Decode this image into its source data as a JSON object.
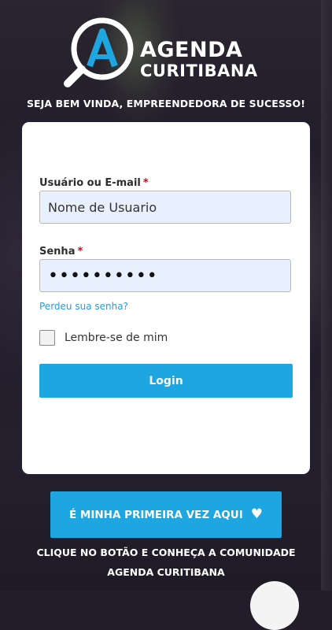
{
  "brand": {
    "line1": "AGENDA",
    "line2": "CURITIBANA",
    "accent_color": "#1ea6e1"
  },
  "tagline": "SEJA BEM VINDA, EMPREENDEDORA DE SUCESSO!",
  "form": {
    "username_label": "Usuário ou E-mail",
    "username_required": "*",
    "username_value": "Nome de Usuario",
    "password_label": "Senha",
    "password_required": "*",
    "password_value": "••••••••••",
    "forgot_link": "Perdeu sua senha?",
    "remember_label": "Lembre-se de mim",
    "remember_checked": false,
    "login_label": "Login"
  },
  "cta": {
    "first_time_label": "É MINHA PRIMEIRA VEZ AQUI",
    "heart_icon": "heart-icon",
    "line1": "CLIQUE NO BOTÃO E CONHEÇA A COMUNIDADE",
    "line2": "AGENDA CURITIBANA"
  },
  "colors": {
    "button": "#1ea6e1",
    "input_bg": "#e8f0fe",
    "required": "#d0021b",
    "link": "#2a9bd8"
  }
}
